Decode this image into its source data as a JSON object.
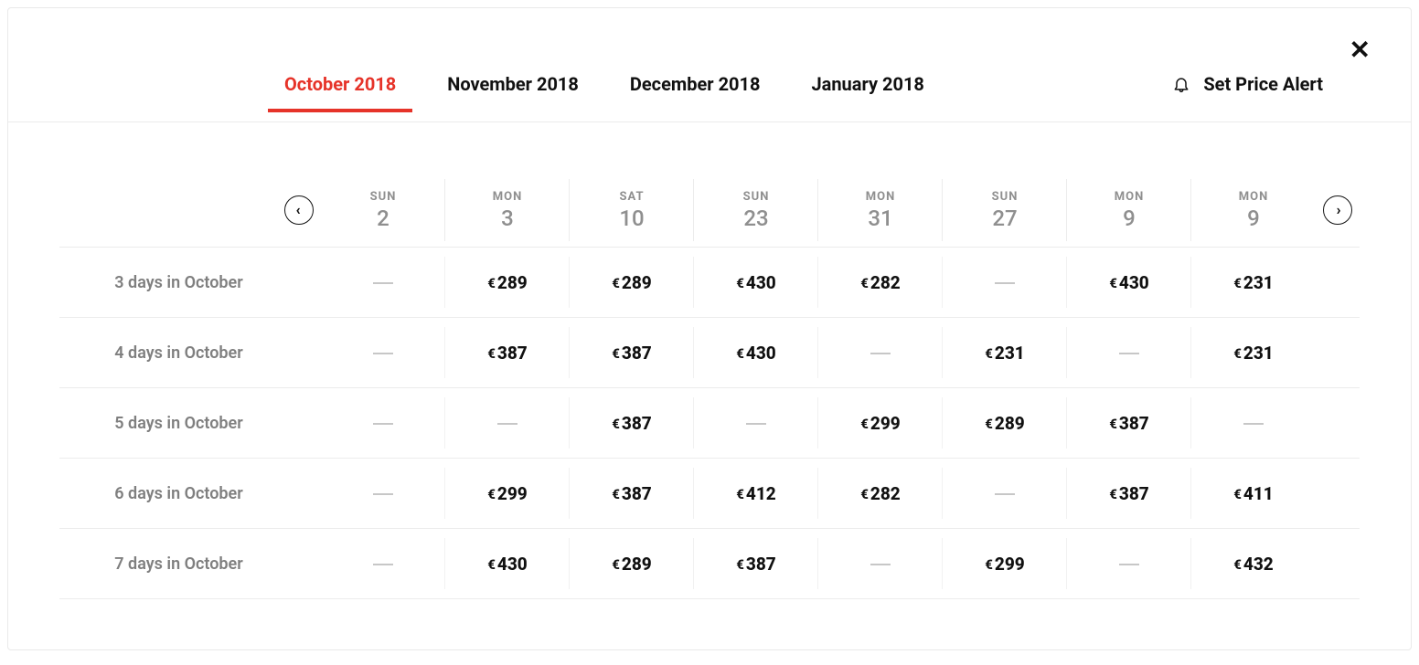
{
  "tabs": {
    "months": [
      {
        "label": "October 2018",
        "active": true
      },
      {
        "label": "November 2018",
        "active": false
      },
      {
        "label": "December 2018",
        "active": false
      },
      {
        "label": "January 2018",
        "active": false
      }
    ],
    "alert_label": "Set Price Alert"
  },
  "currency": "€",
  "dates": [
    {
      "dow": "SUN",
      "day": "2"
    },
    {
      "dow": "MON",
      "day": "3"
    },
    {
      "dow": "SAT",
      "day": "10"
    },
    {
      "dow": "SUN",
      "day": "23"
    },
    {
      "dow": "MON",
      "day": "31"
    },
    {
      "dow": "SUN",
      "day": "27"
    },
    {
      "dow": "MON",
      "day": "9"
    },
    {
      "dow": "MON",
      "day": "9"
    }
  ],
  "rows": [
    {
      "label": "3 days in October",
      "prices": [
        null,
        "289",
        "289",
        "430",
        "282",
        null,
        "430",
        "231"
      ]
    },
    {
      "label": "4 days in October",
      "prices": [
        null,
        "387",
        "387",
        "430",
        null,
        "231",
        null,
        "231"
      ]
    },
    {
      "label": "5 days in October",
      "prices": [
        null,
        null,
        "387",
        null,
        "299",
        "289",
        "387",
        null
      ]
    },
    {
      "label": "6 days in October",
      "prices": [
        null,
        "299",
        "387",
        "412",
        "282",
        null,
        "387",
        "411"
      ]
    },
    {
      "label": "7 days in October",
      "prices": [
        null,
        "430",
        "289",
        "387",
        null,
        "299",
        null,
        "432"
      ]
    }
  ],
  "colors": {
    "accent": "#e63329"
  }
}
